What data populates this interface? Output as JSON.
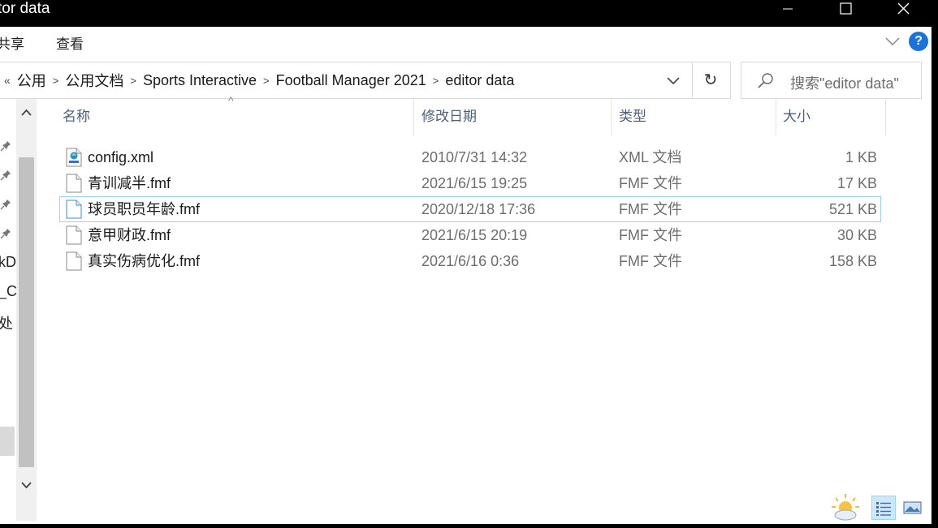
{
  "window": {
    "title": "tor data",
    "controls": {
      "minimize": "–",
      "maximize": "☐",
      "close": "✕"
    }
  },
  "ribbon": {
    "tabs": [
      "共享",
      "查看"
    ],
    "help": "?"
  },
  "address": {
    "lead": "«",
    "breadcrumbs": [
      "公用",
      "公用文档",
      "Sports Interactive",
      "Football Manager 2021",
      "editor data"
    ],
    "refresh": "↻"
  },
  "search": {
    "placeholder": "搜索\"editor data\""
  },
  "nav": {
    "labels": [
      "kD",
      "_C",
      "处"
    ]
  },
  "columns": {
    "name": "名称",
    "date": "修改日期",
    "type": "类型",
    "size": "大小"
  },
  "files": [
    {
      "name": "config.xml",
      "date": "2010/7/31 14:32",
      "type": "XML 文档",
      "size": "1 KB",
      "icon": "xml-file-icon"
    },
    {
      "name": "青训减半.fmf",
      "date": "2021/6/15 19:25",
      "type": "FMF 文件",
      "size": "17 KB",
      "icon": "file-icon"
    },
    {
      "name": "球员职员年龄.fmf",
      "date": "2020/12/18 17:36",
      "type": "FMF 文件",
      "size": "521 KB",
      "icon": "file-icon"
    },
    {
      "name": "意甲财政.fmf",
      "date": "2021/6/15 20:19",
      "type": "FMF 文件",
      "size": "30 KB",
      "icon": "file-icon"
    },
    {
      "name": "真实伤病优化.fmf",
      "date": "2021/6/16 0:36",
      "type": "FMF 文件",
      "size": "158 KB",
      "icon": "file-icon"
    }
  ],
  "focused_row": 2,
  "colors": {
    "accent": "#1a73d9",
    "selection_border": "#99d1ff",
    "header_text": "#4c607a"
  }
}
